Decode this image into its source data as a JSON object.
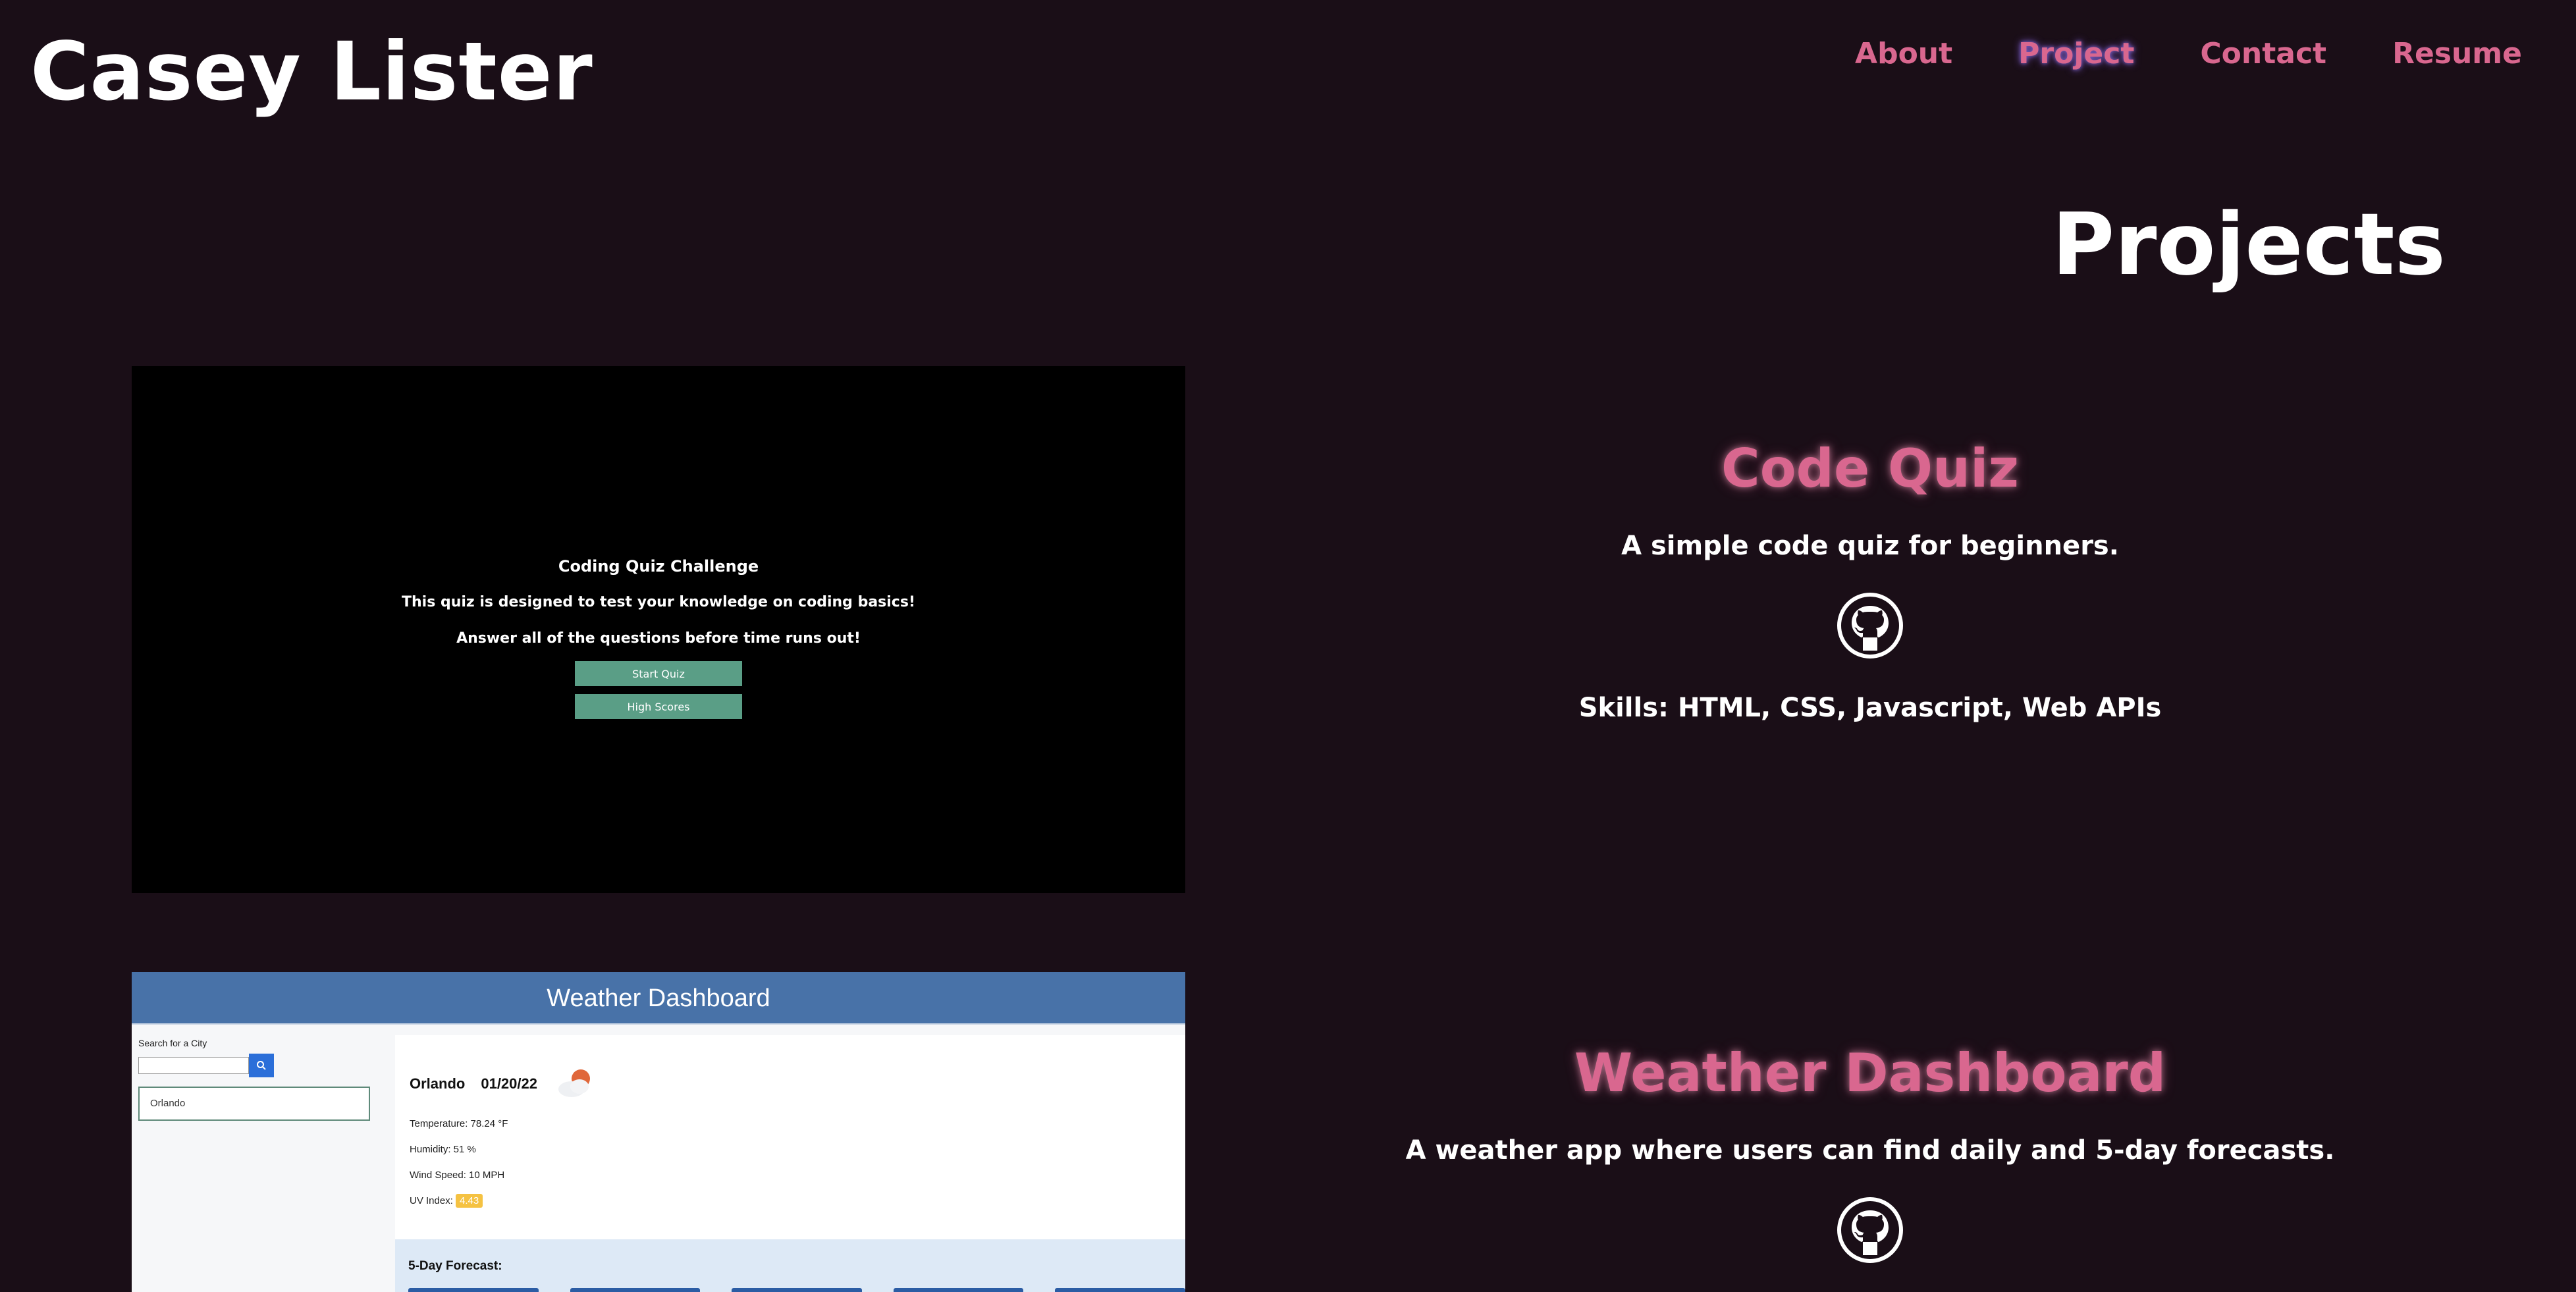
{
  "site": {
    "title": "Casey Lister"
  },
  "nav": {
    "items": [
      "About",
      "Project",
      "Contact",
      "Resume"
    ],
    "active": "Project"
  },
  "section": {
    "title": "Projects"
  },
  "projects": [
    {
      "title": "Code Quiz",
      "description": "A simple code quiz for beginners.",
      "skills": "Skills: HTML, CSS, Javascript, Web APIs",
      "icon": "github-icon",
      "screenshot": {
        "title": "Coding Quiz Challenge",
        "line1": "This quiz is designed to test your knowledge on coding basics!",
        "line2": "Answer all of the questions before time runs out!",
        "start_label": "Start Quiz",
        "scores_label": "High Scores"
      }
    },
    {
      "title": "Weather Dashboard",
      "description": "A weather app where users can find daily and 5-day forecasts.",
      "icon": "github-icon",
      "screenshot": {
        "header": "Weather Dashboard",
        "search_label": "Search for a City",
        "history_item": "Orlando",
        "city": "Orlando",
        "date": "01/20/22",
        "temperature": "Temperature: 78.24 °F",
        "humidity": "Humidity: 51 %",
        "wind": "Wind Speed: 10 MPH",
        "uv_label": "UV Index:",
        "uv_value": "4.43",
        "forecast_title": "5-Day Forecast:"
      }
    }
  ],
  "colors": {
    "background": "#1a0e17",
    "accent": "#d9678f",
    "active_glow": "#7a5cc6"
  }
}
